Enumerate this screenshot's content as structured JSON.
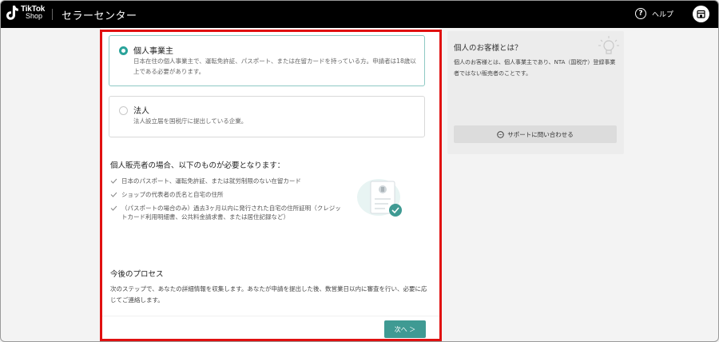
{
  "header": {
    "logo_line1": "TikTok",
    "logo_line2": "Shop",
    "title": "セラーセンター",
    "help_label": "ヘルプ",
    "help_icon": "question-circle-icon",
    "store_icon": "store-icon"
  },
  "options": [
    {
      "title": "個人事業主",
      "desc": "日本在住の個人事業主で、運転免許証、パスポート、または在留カードを持っている方。申請者は18歳以上である必要があります。",
      "selected": true
    },
    {
      "title": "法人",
      "desc": "法人設立届を国税庁に提出している企業。",
      "selected": false
    }
  ],
  "requirements": {
    "title": "個人販売者の場合、以下のものが必要となります：",
    "items": [
      "日本のパスポート、運転免許証、または就労制限のない在留カード",
      "ショップの代表者の氏名と自宅の住所",
      "（パスポートの場合のみ）過去3ヶ月以内に発行された自宅の住所証明（クレジットカード利用明細書、公共料金請求書、または居住記録など）"
    ]
  },
  "process": {
    "title": "今後のプロセス",
    "desc": "次のステップで、あなたの詳細情報を収集します。あなたが申請を提出した後、数営業日以内に審査を行い、必要に応じてご連絡します。"
  },
  "next_button": "次へ ＞",
  "info": {
    "title": "個人のお客様とは？",
    "desc": "個人のお客様とは、個人事業主であり、NTA（国税庁）登録事業者ではない販売者のことです。",
    "support_button": "サポートに問い合わせる"
  },
  "colors": {
    "accent": "#2aa39a",
    "button": "#3f9a93",
    "highlight": "#e01010"
  }
}
